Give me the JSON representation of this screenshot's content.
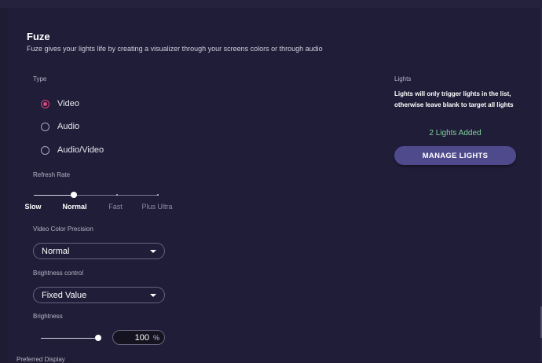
{
  "header": {
    "title": "Fuze",
    "subtitle": "Fuze gives your lights life by creating a visualizer through your screens colors or through audio"
  },
  "type_section": {
    "label": "Type",
    "options": [
      {
        "label": "Video",
        "checked": true
      },
      {
        "label": "Audio",
        "checked": false
      },
      {
        "label": "Audio/Video",
        "checked": false
      }
    ]
  },
  "refresh_rate": {
    "label": "Refresh Rate",
    "steps": [
      "Slow",
      "Normal",
      "Fast",
      "Plus Ultra"
    ],
    "selected": "Normal"
  },
  "video_color_precision": {
    "label": "Video Color Precision",
    "value": "Normal"
  },
  "brightness_control": {
    "label": "Brightness control",
    "value": "Fixed Value"
  },
  "brightness": {
    "label": "Brightness",
    "value": "100",
    "unit": "%"
  },
  "lights": {
    "label": "Lights",
    "description": "Lights will only trigger lights in the list, otherwise leave blank to target all lights",
    "count_text": "2 Lights Added",
    "manage_button": "MANAGE LIGHTS"
  },
  "preferred_display": {
    "label": "Preferred Display"
  },
  "colors": {
    "accent": "#e2447a",
    "button": "#4f4a8c",
    "success": "#7ed39a"
  }
}
